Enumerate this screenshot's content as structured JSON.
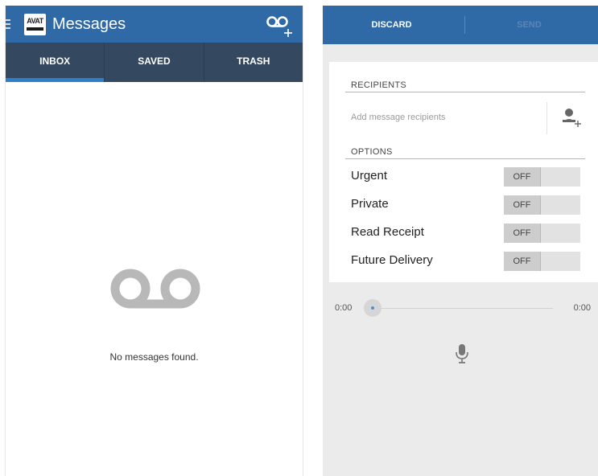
{
  "inbox_screen": {
    "title": "Messages",
    "logo_text": "AVAT",
    "tabs": [
      {
        "label": "INBOX",
        "active": true
      },
      {
        "label": "SAVED",
        "active": false
      },
      {
        "label": "TRASH",
        "active": false
      }
    ],
    "empty_message": "No messages found."
  },
  "compose_screen": {
    "discard_label": "DISCARD",
    "send_label": "SEND",
    "recipients_header": "RECIPIENTS",
    "recipients_placeholder": "Add message recipients",
    "options_header": "OPTIONS",
    "options": [
      {
        "label": "Urgent",
        "state": "OFF"
      },
      {
        "label": "Private",
        "state": "OFF"
      },
      {
        "label": "Read Receipt",
        "state": "OFF"
      },
      {
        "label": "Future Delivery",
        "state": "OFF"
      }
    ],
    "time_elapsed": "0:00",
    "time_total": "0:00"
  },
  "colors": {
    "header_blue": "#2f6aa7",
    "tab_bar": "#34495f",
    "tab_indicator": "#2f7fc8",
    "compose_background": "#ebebeb"
  },
  "icons": {
    "menu": "menu-icon",
    "new_voicemail": "voicemail-plus-icon",
    "empty_state": "voicemail-icon",
    "add_recipient": "add-person-icon",
    "record": "microphone-icon"
  }
}
